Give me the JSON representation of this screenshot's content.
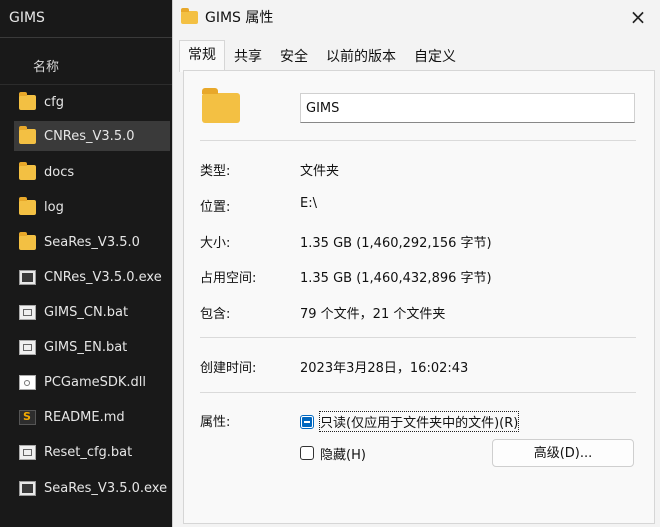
{
  "explorer": {
    "title": "GIMS",
    "column_header": "名称",
    "items": [
      {
        "name": "cfg",
        "type": "folder"
      },
      {
        "name": "CNRes_V3.5.0",
        "type": "folder",
        "selected": true
      },
      {
        "name": "docs",
        "type": "folder"
      },
      {
        "name": "log",
        "type": "folder"
      },
      {
        "name": "SeaRes_V3.5.0",
        "type": "folder"
      },
      {
        "name": "CNRes_V3.5.0.exe",
        "type": "exe"
      },
      {
        "name": "GIMS_CN.bat",
        "type": "bat"
      },
      {
        "name": "GIMS_EN.bat",
        "type": "bat"
      },
      {
        "name": "PCGameSDK.dll",
        "type": "dll"
      },
      {
        "name": "README.md",
        "type": "md"
      },
      {
        "name": "Reset_cfg.bat",
        "type": "bat"
      },
      {
        "name": "SeaRes_V3.5.0.exe",
        "type": "exe"
      }
    ]
  },
  "dialog": {
    "title": "GIMS 属性",
    "close_icon": "×",
    "tabs": [
      {
        "label": "常规",
        "active": true
      },
      {
        "label": "共享"
      },
      {
        "label": "安全"
      },
      {
        "label": "以前的版本"
      },
      {
        "label": "自定义"
      }
    ],
    "name_value": "GIMS",
    "rows": {
      "type_label": "类型:",
      "type_value": "文件夹",
      "location_label": "位置:",
      "location_value": "E:\\",
      "size_label": "大小:",
      "size_value": "1.35 GB (1,460,292,156 字节)",
      "disk_label": "占用空间:",
      "disk_value": "1.35 GB (1,460,432,896 字节)",
      "contains_label": "包含:",
      "contains_value": "79 个文件，21 个文件夹",
      "created_label": "创建时间:",
      "created_value": "2023年3月28日，16:02:43",
      "attributes_label": "属性:"
    },
    "attributes": {
      "readonly_label": "只读(仅应用于文件夹中的文件)(R)",
      "readonly_state": "indeterminate",
      "hidden_label": "隐藏(H)",
      "hidden_checked": false,
      "advanced_button": "高级(D)..."
    }
  },
  "colors": {
    "explorer_bg": "#191919",
    "dialog_bg": "#f3f3f3",
    "accent": "#0067c0",
    "folder": "#f3c043"
  }
}
